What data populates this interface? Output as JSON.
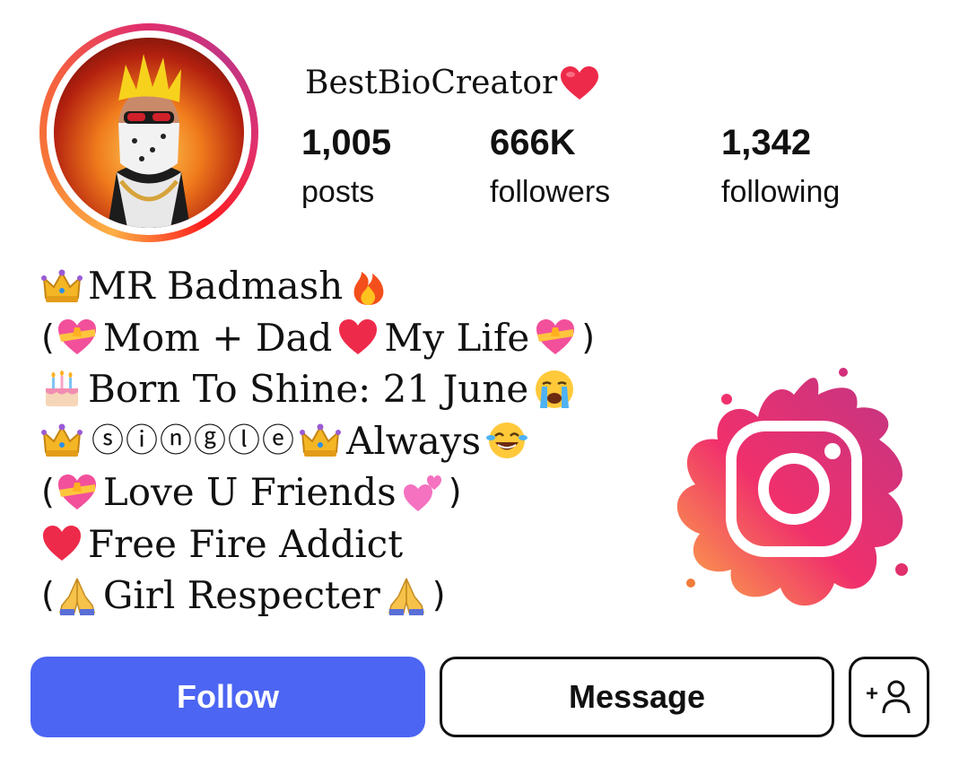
{
  "profile": {
    "username": "BestBioCreator",
    "username_badge_icon": "red-heart-icon"
  },
  "stats": [
    {
      "value": "1,005",
      "label": "posts"
    },
    {
      "value": "666K",
      "label": "followers"
    },
    {
      "value": "1,342",
      "label": "following"
    }
  ],
  "bio": {
    "line1_text": "MR Badmash",
    "line2_text_a": "Mom + Dad",
    "line2_text_b": "My Life",
    "line3_text": "Born To Shine: 21 June",
    "line4_circled": "ⓢⓘⓝⓖⓛⓔ",
    "line4_text": "Always",
    "line5_text": "Love U Friends",
    "line6_text": "Free Fire Addict",
    "line7_text": "Girl Respecter",
    "open_paren": "(",
    "close_paren": ")"
  },
  "actions": {
    "follow_label": "Follow",
    "message_label": "Message",
    "add_friend_label": "+"
  },
  "colors": {
    "follow_button": "#4c65f2",
    "instagram_gradient": [
      "#fcaf45",
      "#e1306c",
      "#c13584"
    ]
  }
}
